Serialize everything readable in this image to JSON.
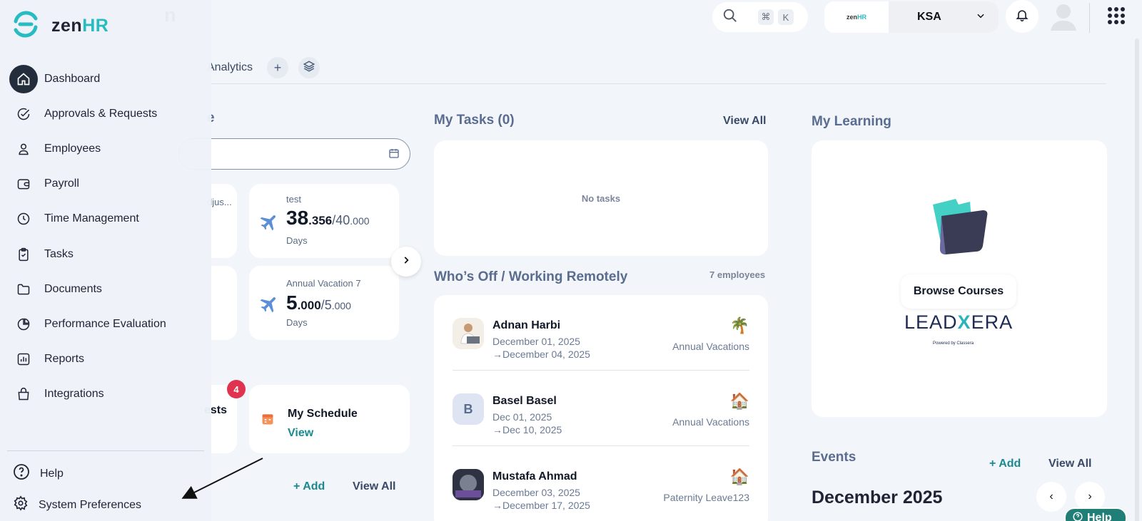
{
  "header": {
    "title_partial": "n",
    "search_shortcut": [
      "⌘",
      "K"
    ],
    "company_logo_text": "zenHR",
    "company_select": "KSA"
  },
  "tabs": {
    "analytics": "Analytics",
    "add": "+"
  },
  "left_column": {
    "card_adjust_partial": "djus...",
    "test_card": {
      "label": "test",
      "value_int": "38",
      "value_dec": ".356",
      "total_int": "40",
      "total_dec": ".000",
      "unit": "Days"
    },
    "annual_card": {
      "label": "Annual Vacation 7",
      "value_int": "5",
      "value_dec": ".000",
      "total_int": "5",
      "total_dec": ".000",
      "unit": "Days"
    },
    "requests_partial": "ests",
    "requests_badge": "4",
    "schedule": {
      "title": "My Schedule",
      "link": "View"
    },
    "add_label": "+ Add",
    "view_all": "View All"
  },
  "tasks": {
    "title": "My Tasks (0)",
    "view_all": "View All",
    "empty": "No tasks"
  },
  "whos_off": {
    "title": "Who’s Off / Working Remotely",
    "count": "7 employees",
    "rows": [
      {
        "name": "Adnan Harbi",
        "from": "December 01, 2025",
        "to": "December 04, 2025",
        "type": "Annual Vacations",
        "icon": "🌴"
      },
      {
        "name": "Basel Basel",
        "initial": "B",
        "from": "Dec 01, 2025",
        "to": "Dec 10, 2025",
        "type": "Annual Vacations",
        "icon": "🏠"
      },
      {
        "name": "Mustafa Ahmad",
        "from": "December 03, 2025",
        "to": "December 17, 2025",
        "type": "Paternity Leave123",
        "icon": "🏠"
      }
    ]
  },
  "learning": {
    "title": "My Learning",
    "browse": "Browse Courses",
    "partner_pre": "LEAD",
    "partner_x": "X",
    "partner_post": "ERA",
    "partner_sub": "Powered by Classera"
  },
  "events": {
    "title": "Events",
    "add": "+ Add",
    "view_all": "View All",
    "month": "December 2025"
  },
  "help_float": "Help",
  "sidebar": {
    "logo_text": "zen",
    "logo_text_accent": "HR",
    "items": [
      {
        "label": "Dashboard",
        "icon": "home-icon"
      },
      {
        "label": "Approvals & Requests",
        "icon": "check-circle-icon"
      },
      {
        "label": "Employees",
        "icon": "user-icon"
      },
      {
        "label": "Payroll",
        "icon": "wallet-icon"
      },
      {
        "label": "Time Management",
        "icon": "clock-icon"
      },
      {
        "label": "Tasks",
        "icon": "clipboard-icon"
      },
      {
        "label": "Documents",
        "icon": "folder-icon"
      },
      {
        "label": "Performance Evaluation",
        "icon": "pie-chart-icon"
      },
      {
        "label": "Reports",
        "icon": "bar-chart-icon"
      },
      {
        "label": "Integrations",
        "icon": "bag-icon"
      }
    ],
    "help": "Help",
    "system_preferences": "System Preferences"
  },
  "colors": {
    "accent": "#27bcc2",
    "link": "#1a8a8f",
    "badge": "#e0334f",
    "sidebar_active": "#242d3b"
  }
}
